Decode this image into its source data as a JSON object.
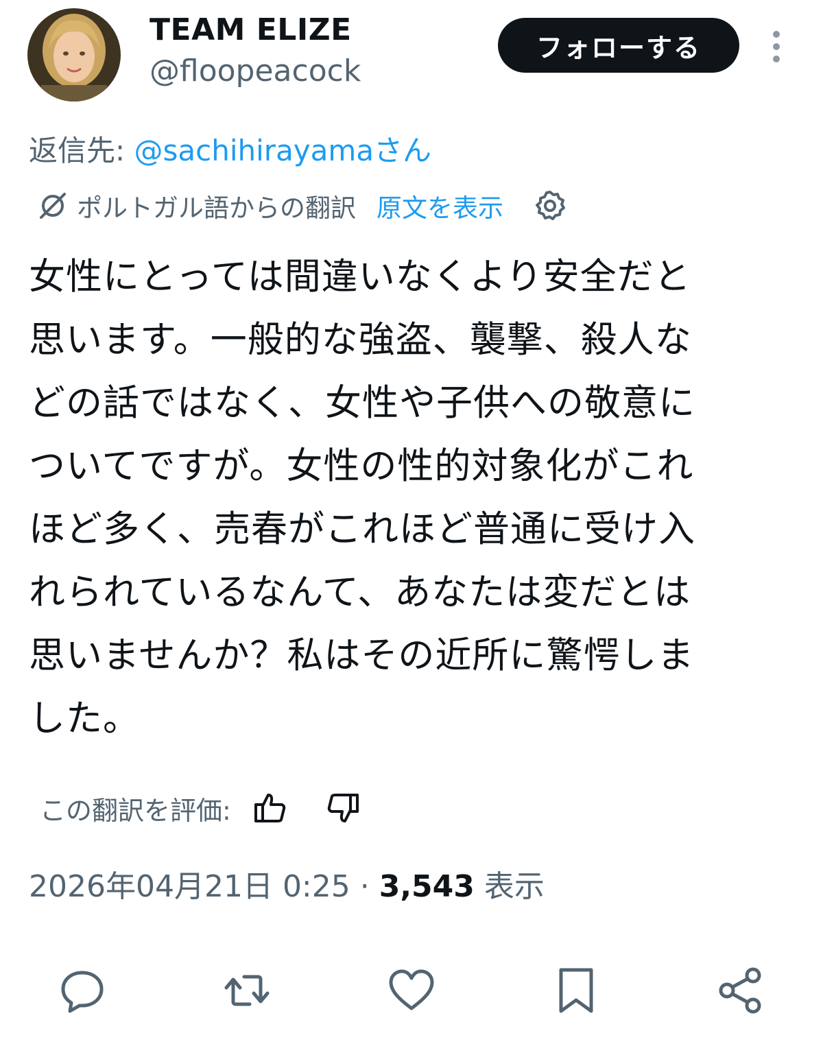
{
  "user": {
    "display_name": "TEAM ELIZE",
    "handle": "@floopeacock",
    "avatar_icon": "user-avatar"
  },
  "header": {
    "follow_label": "フォローする",
    "more_icon": "more-vertical-icon"
  },
  "reply": {
    "prefix": "返信先: ",
    "mention": "@sachihirayamaさん"
  },
  "translation": {
    "label": "ポルトガル語からの翻訳",
    "show_original": "原文を表示",
    "settings_icon": "gear-icon"
  },
  "tweet": {
    "text": "女性にとっては間違いなくより安全だと\n思います。一般的な強盗、襲撃、殺人な\nどの話ではなく、女性や子供への敬意に\nついてですが。女性の性的対象化がこれ\nほど多く、売春がこれほど普通に受け入\nれられているなんて、あなたは変だとは\n思いませんか？私はその近所に驚愕しま\nした。"
  },
  "rating": {
    "label": "この翻訳を評価:",
    "up_icon": "thumbs-up-icon",
    "down_icon": "thumbs-down-icon"
  },
  "meta": {
    "timestamp": "2026年04月21日 0:25 · ",
    "views_count": "3,543",
    "views_label": " 表示"
  },
  "action_bar": {
    "icons": [
      "reply-icon",
      "retweet-icon",
      "like-icon",
      "bookmark-icon",
      "share-icon"
    ]
  },
  "colors": {
    "text": "#0f1419",
    "secondary": "#536471",
    "accent": "#1d9bf0",
    "button": "#0f1419"
  }
}
